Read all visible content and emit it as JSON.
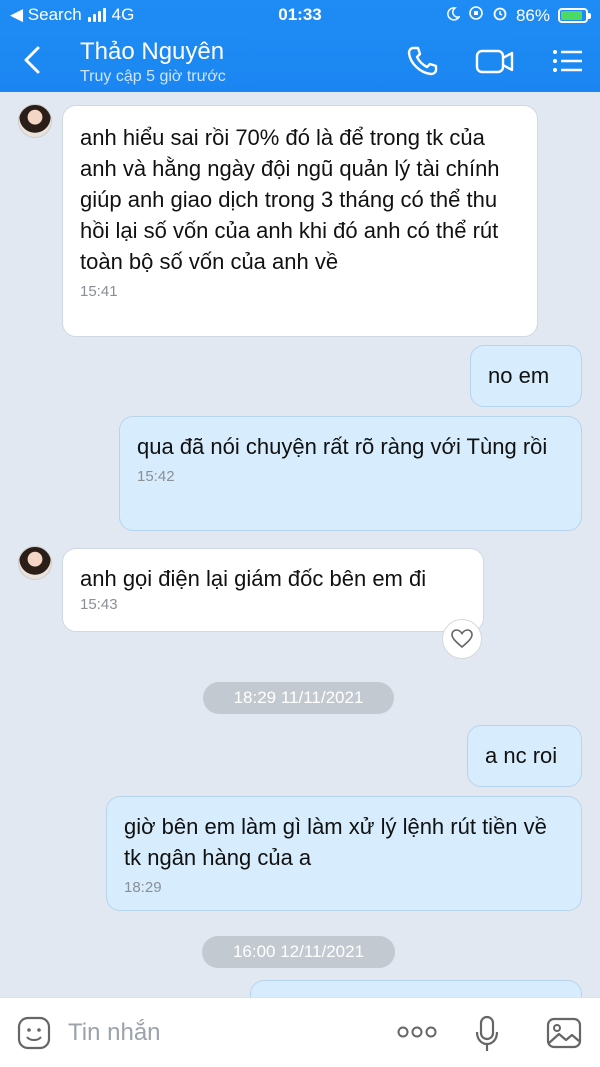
{
  "status_bar": {
    "back_app": "◀ Search",
    "network": "4G",
    "time": "01:33",
    "battery": "86%"
  },
  "header": {
    "contact_name": "Thảo Nguyên",
    "contact_status": "Truy cập 5 giờ trước",
    "icons": [
      "back-icon",
      "phone-icon",
      "video-icon",
      "menu-icon"
    ]
  },
  "messages": [
    {
      "side": "in",
      "text": "anh hiểu sai rồi 70% đó là để trong tk của anh và hằng ngày đội ngũ quản lý tài chính giúp anh giao dịch trong 3 tháng có thể thu hồi lại số vốn của anh khi đó anh có thể rút toàn bộ số vốn của anh về",
      "time": "15:41"
    },
    {
      "side": "out",
      "text": "no em",
      "time": ""
    },
    {
      "side": "out",
      "text": "qua đã nói chuyện rất rõ ràng với Tùng rồi",
      "time": "15:42"
    },
    {
      "side": "in",
      "text": "anh gọi điện lại giám đốc bên em đi",
      "time": "15:43"
    },
    {
      "side": "out",
      "text": "a nc roi",
      "time": ""
    },
    {
      "side": "out",
      "text": "giờ bên em làm gì làm xử lý lệnh rút tiền về tk ngân hàng của a",
      "time": "18:29"
    }
  ],
  "date_separators": [
    "18:29 11/11/2021",
    "16:00 12/11/2021"
  ],
  "input": {
    "placeholder": "Tin nhắn",
    "value": ""
  },
  "colors": {
    "header": "#1b86f1",
    "background": "#e2e8f1",
    "outgoing_bubble": "#d7ecfd",
    "incoming_bubble": "#ffffff",
    "battery_fill": "#4cd964"
  }
}
